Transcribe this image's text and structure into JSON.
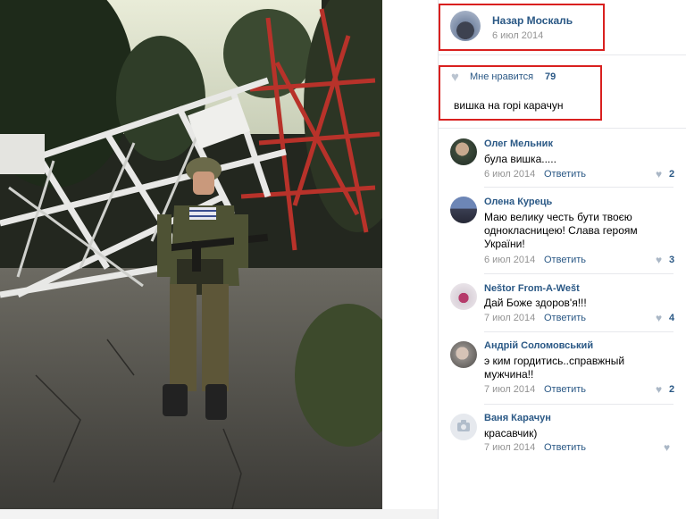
{
  "photo": {
    "description_icon": "soldier-photo"
  },
  "post": {
    "author": "Назар Москаль",
    "date": "6 июл 2014",
    "likes_label": "Мне нравится",
    "likes_count": "79",
    "text": "вишка на горі карачун"
  },
  "comments": [
    {
      "author": "Олег Мельник",
      "text": "була вишка.....",
      "date": "6 июл 2014",
      "reply": "Ответить",
      "likes": "2"
    },
    {
      "author": "Олена Курець",
      "text": "Маю велику честь бути твоєю однокласницею! Слава героям України!",
      "date": "6 июл 2014",
      "reply": "Ответить",
      "likes": "3"
    },
    {
      "author": "Neštor From-A-Wešt",
      "text": "Дай Боже здоров'я!!!",
      "date": "7 июл 2014",
      "reply": "Ответить",
      "likes": "4"
    },
    {
      "author": "Андрій Соломовський",
      "text": "э ким гордитись..справжный мужчина!!",
      "date": "7 июл 2014",
      "reply": "Ответить",
      "likes": "2"
    },
    {
      "author": "Ваня Карачун",
      "text": "красавчик)",
      "date": "7 июл 2014",
      "reply": "Ответить",
      "likes": ""
    }
  ],
  "colors": {
    "link": "#2a5885",
    "muted": "#939393",
    "highlight_box": "#d9201f"
  }
}
